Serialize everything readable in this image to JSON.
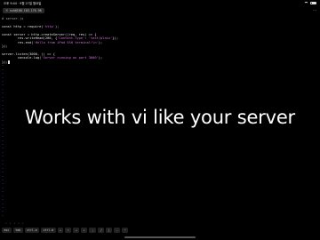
{
  "status": {
    "time": "오후 9:44 · 9월 27일 월요일",
    "wifi_icon": "wifi-icon",
    "battery_icon": "battery-icon"
  },
  "tab": {
    "label": "ssh@100.103.176.98",
    "close_glyph": "×",
    "more_glyph": "···"
  },
  "editor": {
    "lines": [
      {
        "kind": "comment",
        "text": "# server.js"
      },
      {
        "kind": "blank",
        "text": ""
      },
      {
        "kind": "code",
        "text": "const http = require('http');"
      },
      {
        "kind": "blank",
        "text": ""
      },
      {
        "kind": "code",
        "text": "const server = http.createServer((req, res) => {"
      },
      {
        "kind": "code",
        "text": "        res.writeHead(200, {'Content-Type': 'text/plain'});"
      },
      {
        "kind": "code",
        "text": "        res.end('Hello from iPad SSH terminal!\\n');"
      },
      {
        "kind": "code",
        "text": "});"
      },
      {
        "kind": "blank",
        "text": ""
      },
      {
        "kind": "code",
        "text": "server.listen(3000, () => {"
      },
      {
        "kind": "code",
        "text": "        console.log('Server running on port 3000');"
      },
      {
        "kind": "cursor",
        "text": "});"
      }
    ],
    "tilde_glyph": "~",
    "tilde_count": 39
  },
  "caption": "Works with vi like your server",
  "scroll_dots": "• • • • •",
  "keys": {
    "left": [
      "esc",
      "tab",
      "ctrl-a",
      "ctrl-d"
    ],
    "right": [
      "←",
      "↑",
      "→",
      "↓",
      "⋮",
      "/",
      "|",
      "-",
      "~"
    ]
  }
}
